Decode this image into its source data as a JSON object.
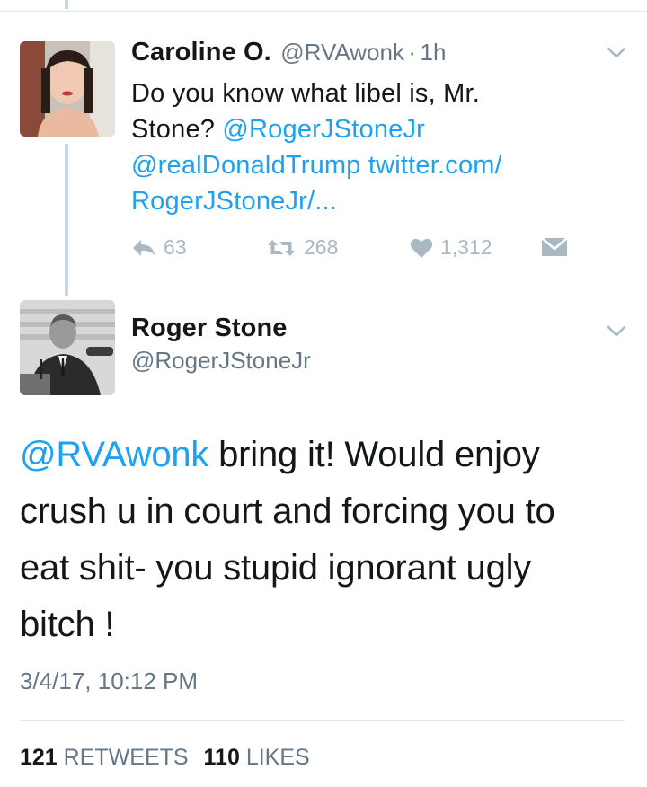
{
  "reply_tweet": {
    "author_name": "Caroline O.",
    "author_handle": "@RVAwonk",
    "separator": "·",
    "time": "1h",
    "text_1": "Do you know what libel is, Mr.",
    "text_2_prefix": "Stone? ",
    "mention_1": "@RogerJStoneJr",
    "mention_2": "@realDonaldTrump",
    "link_1": "twitter.com/",
    "link_2": "RogerJStoneJr/...",
    "replies": "63",
    "retweets": "268",
    "likes": "1,312"
  },
  "main_tweet": {
    "author_name": "Roger Stone",
    "author_handle": "@RogerJStoneJr",
    "mention": "@RVAwonk",
    "text_line1_rest": " bring it! Would enjoy",
    "text_line2": "crush u in court and forcing you to",
    "text_line3": "eat shit- you stupid ignorant ugly",
    "text_line4": "bitch !",
    "timestamp": "3/4/17, 10:12 PM",
    "retweet_count": "121",
    "retweet_label": "RETWEETS",
    "like_count": "110",
    "like_label": "LIKES"
  },
  "colors": {
    "link": "#1da1f2",
    "icon_gray": "#aab8c2",
    "text_gray": "#657786"
  },
  "icons": [
    "reply-icon",
    "retweet-icon",
    "like-icon",
    "direct-message-icon",
    "chevron-down-icon"
  ]
}
